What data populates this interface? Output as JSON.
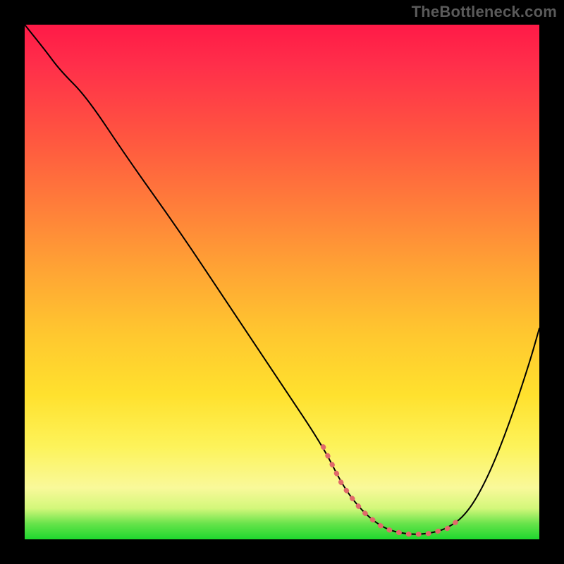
{
  "watermark": "TheBottleneck.com",
  "chart_data": {
    "type": "line",
    "title": "",
    "xlabel": "",
    "ylabel": "",
    "xlim": [
      0,
      100
    ],
    "ylim": [
      0,
      100
    ],
    "grid": false,
    "legend": false,
    "series": [
      {
        "name": "bottleneck-curve",
        "x": [
          0,
          4,
          7,
          12,
          20,
          30,
          40,
          50,
          58,
          62,
          66,
          70,
          74,
          78,
          82,
          86,
          90,
          94,
          98,
          100
        ],
        "y": [
          100,
          95,
          91,
          86,
          74,
          60,
          45,
          30,
          18,
          10,
          5,
          2,
          1,
          1,
          2,
          5,
          12,
          22,
          34,
          41
        ]
      }
    ],
    "annotations": [
      {
        "name": "optimal-region-dots",
        "x_range": [
          58,
          84
        ],
        "y_approx": 1,
        "style": "dotted-salmon"
      }
    ],
    "background_gradient": {
      "stops": [
        {
          "pct": 0,
          "color": "#ff1a47"
        },
        {
          "pct": 22,
          "color": "#ff5640"
        },
        {
          "pct": 48,
          "color": "#ffa534"
        },
        {
          "pct": 72,
          "color": "#ffe12e"
        },
        {
          "pct": 90,
          "color": "#f9f99a"
        },
        {
          "pct": 100,
          "color": "#1ed72e"
        }
      ]
    }
  }
}
